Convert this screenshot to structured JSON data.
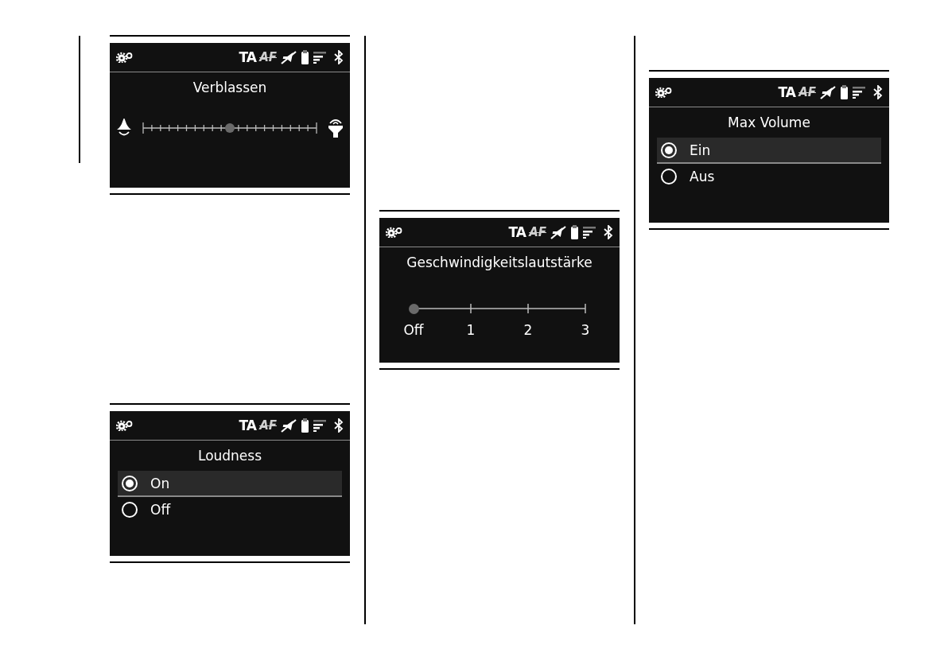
{
  "columns": [
    {
      "screens": [
        {
          "kind": "fade",
          "status": {
            "ta": "TA",
            "af": "AF"
          },
          "title": "Verblassen",
          "level": 0.5
        },
        {
          "kind": "radio",
          "status": {
            "ta": "TA",
            "af": "AF"
          },
          "title": "Loudness",
          "options": [
            {
              "label": "On",
              "selected": true
            },
            {
              "label": "Off",
              "selected": false
            }
          ]
        }
      ]
    },
    {
      "screens": [
        {
          "kind": "steps",
          "status": {
            "ta": "TA",
            "af": "AF"
          },
          "title": "Geschwindigkeitslautstärke",
          "labels": [
            "Off",
            "1",
            "2",
            "3"
          ],
          "level": 0
        }
      ]
    },
    {
      "screens": [
        {
          "kind": "radio",
          "status": {
            "ta": "TA",
            "af": "AF"
          },
          "title": "Max Volume",
          "options": [
            {
              "label": "Ein",
              "selected": true
            },
            {
              "label": "Aus",
              "selected": false
            }
          ]
        }
      ]
    }
  ]
}
